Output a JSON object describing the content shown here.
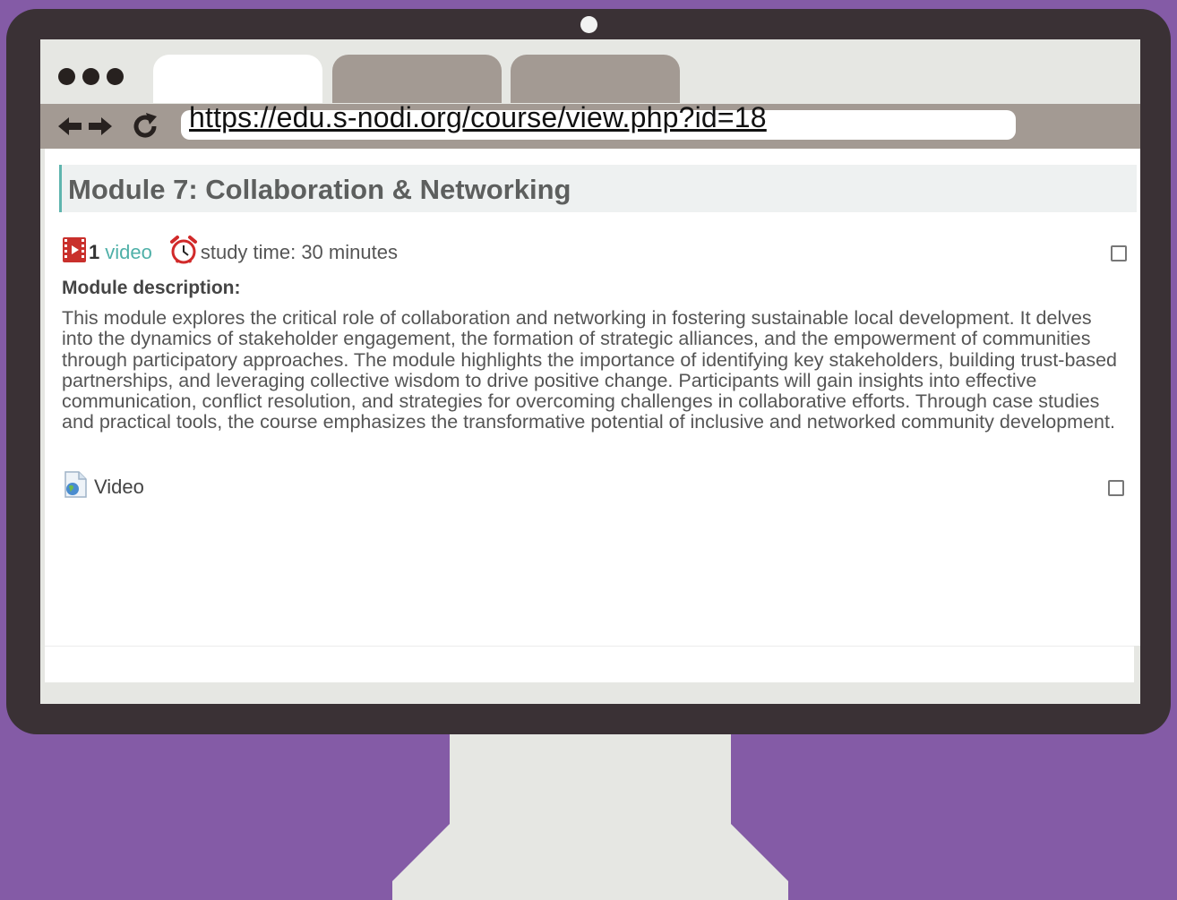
{
  "browser": {
    "url": "https://edu.s-nodi.org/course/view.php?id=18"
  },
  "icons": {
    "back": "arrow-left-icon",
    "forward": "arrow-right-icon",
    "reload": "reload-icon",
    "video": "film-icon",
    "clock": "alarm-clock-icon",
    "resource": "document-globe-icon"
  },
  "colors": {
    "background": "#845ba6",
    "monitor": "#3a3135",
    "accent": "#4fb0a8",
    "tab_inactive": "#a39a93"
  },
  "module": {
    "title": "Module 7: Collaboration & Networking",
    "video_count": "1",
    "video_word": "video",
    "study_time": "study time: 30 minutes",
    "description_label": "Module description:",
    "description": "This module explores the critical role of collaboration and networking in fostering sustainable local development. It delves into the dynamics of stakeholder engagement, the formation of strategic alliances, and the empowerment of communities through participatory approaches. The module highlights the importance of identifying key stakeholders, building trust-based partnerships, and leveraging collective wisdom to drive positive change. Participants will gain insights into effective communication, conflict resolution, and strategies for overcoming challenges in collaborative efforts. Through case studies and practical tools, the course emphasizes the transformative potential of inclusive and networked community development.",
    "resource_label": "Video"
  }
}
